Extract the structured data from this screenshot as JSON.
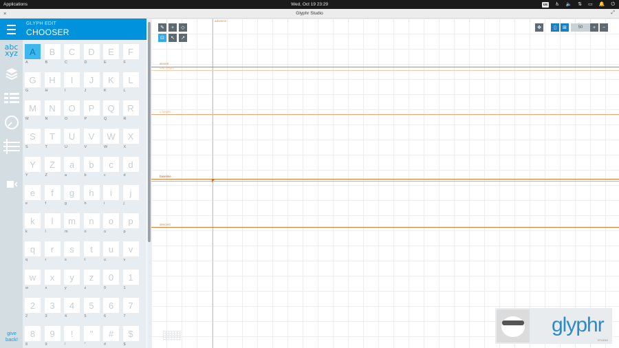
{
  "topbar": {
    "applications": "Applications",
    "clock": "Wed, Oct 19  23:29",
    "lang": "us",
    "icons": [
      "accessibility-icon",
      "volume-icon",
      "network-icon",
      "battery-icon",
      "notifications-icon",
      "power-icon"
    ]
  },
  "window": {
    "title": "Glyphr Studio",
    "close": "×",
    "expand": "⤢"
  },
  "rail": {
    "items": [
      "menu-icon",
      "glyph-edit-icon",
      "layers-icon",
      "attributes-icon",
      "history-icon",
      "guides-icon",
      "save-icon"
    ],
    "glyph_icon_line1": "abc",
    "glyph_icon_line2": "xyz",
    "give_back": "give back!"
  },
  "panel": {
    "subtitle": "GLYPH EDIT",
    "title": "CHOOSER",
    "selected_glyph": "A",
    "glyphs": [
      {
        "char": "A",
        "label": "A"
      },
      {
        "char": "B",
        "label": "B"
      },
      {
        "char": "C",
        "label": "C"
      },
      {
        "char": "D",
        "label": "D"
      },
      {
        "char": "E",
        "label": "E"
      },
      {
        "char": "F",
        "label": "F"
      },
      {
        "char": "G",
        "label": "G"
      },
      {
        "char": "H",
        "label": "H"
      },
      {
        "char": "I",
        "label": "I"
      },
      {
        "char": "J",
        "label": "J"
      },
      {
        "char": "K",
        "label": "K"
      },
      {
        "char": "L",
        "label": "L"
      },
      {
        "char": "M",
        "label": "M"
      },
      {
        "char": "N",
        "label": "N"
      },
      {
        "char": "O",
        "label": "O"
      },
      {
        "char": "P",
        "label": "P"
      },
      {
        "char": "Q",
        "label": "Q"
      },
      {
        "char": "R",
        "label": "R"
      },
      {
        "char": "S",
        "label": "S"
      },
      {
        "char": "T",
        "label": "T"
      },
      {
        "char": "U",
        "label": "U"
      },
      {
        "char": "V",
        "label": "V"
      },
      {
        "char": "W",
        "label": "W"
      },
      {
        "char": "X",
        "label": "X"
      },
      {
        "char": "Y",
        "label": "Y"
      },
      {
        "char": "Z",
        "label": "Z"
      },
      {
        "char": "a",
        "label": "a"
      },
      {
        "char": "b",
        "label": "b"
      },
      {
        "char": "c",
        "label": "c"
      },
      {
        "char": "d",
        "label": "d"
      },
      {
        "char": "e",
        "label": "e"
      },
      {
        "char": "f",
        "label": "f"
      },
      {
        "char": "g",
        "label": "g"
      },
      {
        "char": "h",
        "label": "h"
      },
      {
        "char": "i",
        "label": "i"
      },
      {
        "char": "j",
        "label": "j"
      },
      {
        "char": "k",
        "label": "k"
      },
      {
        "char": "l",
        "label": "l"
      },
      {
        "char": "m",
        "label": "m"
      },
      {
        "char": "n",
        "label": "n"
      },
      {
        "char": "o",
        "label": "o"
      },
      {
        "char": "p",
        "label": "p"
      },
      {
        "char": "q",
        "label": "q"
      },
      {
        "char": "r",
        "label": "r"
      },
      {
        "char": "s",
        "label": "s"
      },
      {
        "char": "t",
        "label": "t"
      },
      {
        "char": "u",
        "label": "u"
      },
      {
        "char": "v",
        "label": "v"
      },
      {
        "char": "w",
        "label": "w"
      },
      {
        "char": "x",
        "label": "x"
      },
      {
        "char": "y",
        "label": "y"
      },
      {
        "char": "z",
        "label": "z"
      },
      {
        "char": "0",
        "label": "0"
      },
      {
        "char": "1",
        "label": "1"
      },
      {
        "char": "2",
        "label": "2"
      },
      {
        "char": "3",
        "label": "3"
      },
      {
        "char": "4",
        "label": "4"
      },
      {
        "char": "5",
        "label": "5"
      },
      {
        "char": "6",
        "label": "6"
      },
      {
        "char": "7",
        "label": "7"
      },
      {
        "char": "8",
        "label": "8"
      },
      {
        "char": "9",
        "label": "9"
      },
      {
        "char": "!",
        "label": "!"
      },
      {
        "char": "\"",
        "label": "\""
      },
      {
        "char": "#",
        "label": "#"
      },
      {
        "char": "$",
        "label": "$"
      }
    ]
  },
  "canvas": {
    "guides": {
      "advance": "advance",
      "ascent": "ascent",
      "cap_height": "cap height",
      "x_height": "x height",
      "baseline": "baseline",
      "descent": "descent"
    },
    "toolbar_left": [
      "pen-tool-icon",
      "add-point-icon",
      "path-edit-icon",
      "shape-resize-icon",
      "pointer-icon",
      "kern-icon"
    ],
    "toolbar_right": [
      "pan-icon",
      "fit-height-icon",
      "fit-glyph-icon"
    ],
    "zoom": "50",
    "zoom_in": "+",
    "zoom_out": "−"
  },
  "logo": {
    "wordmark": "glyphr",
    "sub": "STUDIO"
  },
  "colors": {
    "accent": "#0092dc",
    "guide": "#e47a2e",
    "panel_bg": "#e7edf0",
    "rail_bg": "#d4dde2"
  }
}
